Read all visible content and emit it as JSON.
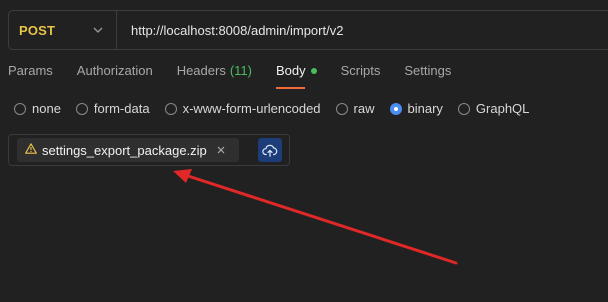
{
  "request": {
    "method": "POST",
    "url": "http://localhost:8008/admin/import/v2"
  },
  "tabs": [
    {
      "label": "Params"
    },
    {
      "label": "Authorization"
    },
    {
      "label": "Headers",
      "count": "(11)"
    },
    {
      "label": "Body"
    },
    {
      "label": "Scripts"
    },
    {
      "label": "Settings"
    }
  ],
  "body_types": [
    {
      "label": "none"
    },
    {
      "label": "form-data"
    },
    {
      "label": "x-www-form-urlencoded"
    },
    {
      "label": "raw"
    },
    {
      "label": "binary"
    },
    {
      "label": "GraphQL"
    }
  ],
  "selected_body_type": "binary",
  "active_tab": "Body",
  "file": {
    "name": "settings_export_package.zip",
    "status_icon": "warning-icon"
  },
  "colors": {
    "method": "#e8c547",
    "active_underline": "#f26b3a",
    "header_count": "#4cbb5e",
    "radio_selected": "#4a8ef0",
    "upload_button": "#1c3d7a",
    "annotation_arrow": "#e02828"
  }
}
